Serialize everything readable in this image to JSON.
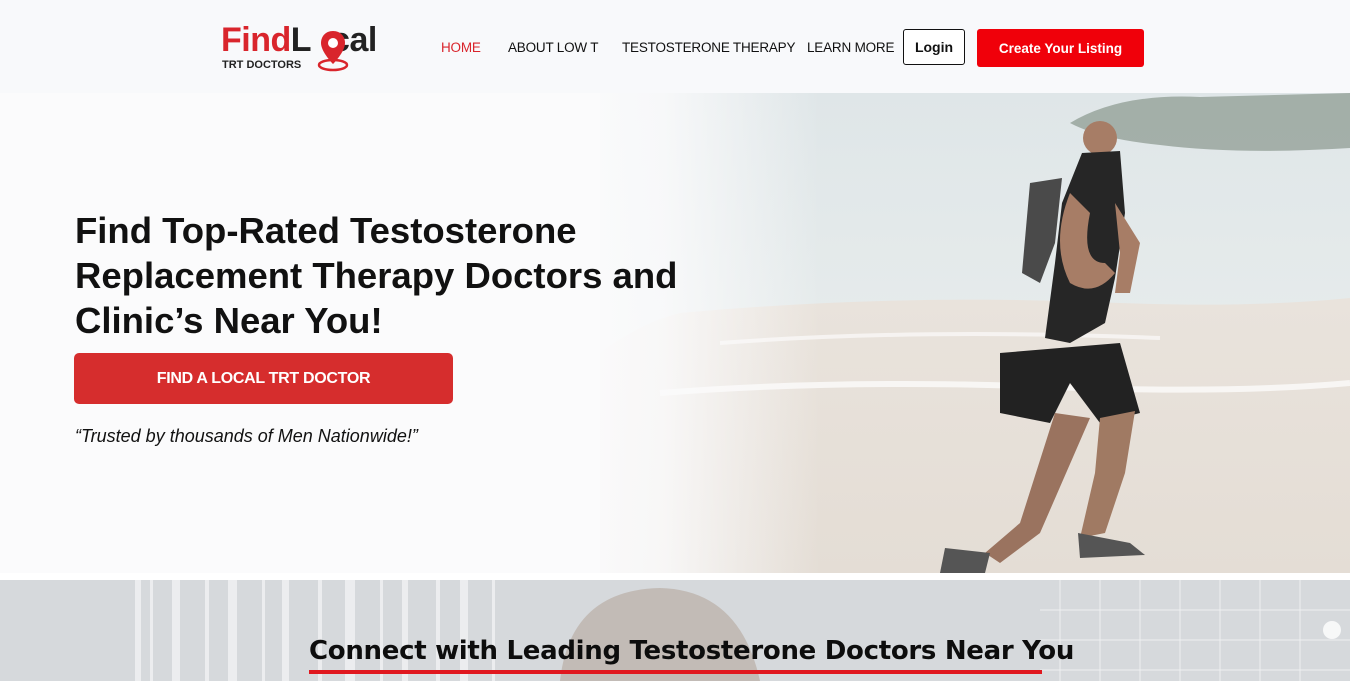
{
  "brand": {
    "logo_part1": "Find",
    "logo_part2": "L",
    "logo_part3": "cal",
    "logo_sub": "TRT DOCTORS",
    "accent_color": "#d9252c"
  },
  "nav": {
    "items": [
      {
        "label": "HOME",
        "active": true
      },
      {
        "label": "ABOUT LOW T",
        "active": false
      },
      {
        "label": "TESTOSTERONE THERAPY",
        "active": false
      },
      {
        "label": "LEARN MORE",
        "active": false
      }
    ],
    "login_label": "Login",
    "create_label": "Create Your Listing"
  },
  "hero": {
    "title": "Find Top-Rated Testosterone Replacement Therapy Doctors and Clinic’s Near You!",
    "cta_label": "FIND A LOCAL TRT DOCTOR",
    "quote": "“Trusted by thousands of Men Nationwide!”"
  },
  "section2": {
    "heading": "Connect with Leading Testosterone Doctors Near You"
  }
}
